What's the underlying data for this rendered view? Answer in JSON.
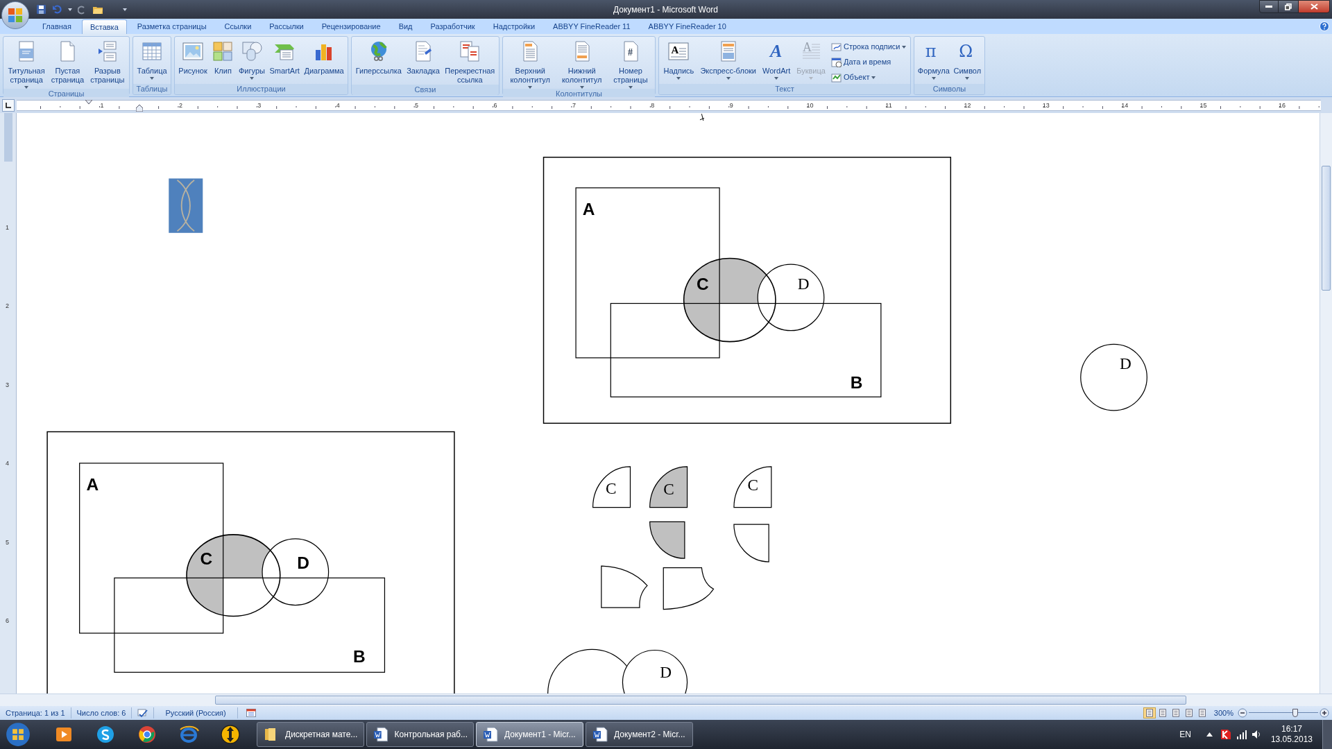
{
  "window": {
    "title": "Документ1 - Microsoft Word"
  },
  "tabs": [
    {
      "label": "Главная",
      "selected": false
    },
    {
      "label": "Вставка",
      "selected": true
    },
    {
      "label": "Разметка страницы",
      "selected": false
    },
    {
      "label": "Ссылки",
      "selected": false
    },
    {
      "label": "Рассылки",
      "selected": false
    },
    {
      "label": "Рецензирование",
      "selected": false
    },
    {
      "label": "Вид",
      "selected": false
    },
    {
      "label": "Разработчик",
      "selected": false
    },
    {
      "label": "Надстройки",
      "selected": false
    },
    {
      "label": "ABBYY FineReader 11",
      "selected": false
    },
    {
      "label": "ABBYY FineReader 10",
      "selected": false
    }
  ],
  "ribbon": {
    "groups": [
      {
        "label": "Страницы",
        "buttons": [
          {
            "kind": "large",
            "label": "Титульная\nстраница",
            "dropdown": true,
            "disabled": false
          },
          {
            "kind": "large",
            "label": "Пустая\nстраница",
            "dropdown": false,
            "disabled": false
          },
          {
            "kind": "large",
            "label": "Разрыв\nстраницы",
            "dropdown": false,
            "disabled": false
          }
        ]
      },
      {
        "label": "Таблицы",
        "buttons": [
          {
            "kind": "large",
            "label": "Таблица",
            "dropdown": true,
            "disabled": false
          }
        ]
      },
      {
        "label": "Иллюстрации",
        "buttons": [
          {
            "kind": "large",
            "label": "Рисунок",
            "dropdown": false,
            "disabled": false
          },
          {
            "kind": "large",
            "label": "Клип",
            "dropdown": false,
            "disabled": false
          },
          {
            "kind": "large",
            "label": "Фигуры",
            "dropdown": true,
            "disabled": false
          },
          {
            "kind": "large",
            "label": "SmartArt",
            "dropdown": false,
            "disabled": false
          },
          {
            "kind": "large",
            "label": "Диаграмма",
            "dropdown": false,
            "disabled": false
          }
        ]
      },
      {
        "label": "Связи",
        "buttons": [
          {
            "kind": "large",
            "label": "Гиперссылка",
            "dropdown": false,
            "disabled": false
          },
          {
            "kind": "large",
            "label": "Закладка",
            "dropdown": false,
            "disabled": false
          },
          {
            "kind": "large",
            "label": "Перекрестная\nссылка",
            "dropdown": false,
            "disabled": false
          }
        ]
      },
      {
        "label": "Колонтитулы",
        "buttons": [
          {
            "kind": "large",
            "label": "Верхний\nколонтитул",
            "dropdown": true,
            "disabled": false
          },
          {
            "kind": "large",
            "label": "Нижний\nколонтитул",
            "dropdown": true,
            "disabled": false
          },
          {
            "kind": "large",
            "label": "Номер\nстраницы",
            "dropdown": true,
            "disabled": false,
            "glyph": "#"
          }
        ]
      },
      {
        "label": "Текст",
        "buttons": [
          {
            "kind": "large",
            "label": "Надпись",
            "dropdown": true,
            "disabled": false,
            "glyph": "A"
          },
          {
            "kind": "large",
            "label": "Экспресс-блоки",
            "dropdown": true,
            "disabled": false
          },
          {
            "kind": "large",
            "label": "WordArt",
            "dropdown": true,
            "disabled": false,
            "glyph": "A"
          },
          {
            "kind": "large",
            "label": "Буквица",
            "dropdown": true,
            "disabled": true,
            "glyph": "A"
          },
          {
            "kind": "small",
            "label": "Строка подписи",
            "dropdown": true,
            "disabled": false
          },
          {
            "kind": "small",
            "label": "Дата и время",
            "dropdown": false,
            "disabled": false
          },
          {
            "kind": "small",
            "label": "Объект",
            "dropdown": true,
            "disabled": false
          }
        ]
      },
      {
        "label": "Символы",
        "buttons": [
          {
            "kind": "large",
            "label": "Формула",
            "dropdown": true,
            "disabled": false,
            "glyph": "π"
          },
          {
            "kind": "large",
            "label": "Символ",
            "dropdown": true,
            "disabled": false,
            "glyph": "Ω"
          }
        ]
      }
    ]
  },
  "ruler": {
    "marks": [
      "1",
      "2",
      "3",
      "4",
      "5",
      "6",
      "7",
      "8",
      "9",
      "10",
      "11",
      "12",
      "13",
      "14",
      "15",
      "16"
    ]
  },
  "vertical_ruler": {
    "marks": [
      "1",
      "2",
      "3",
      "4",
      "5",
      "6"
    ]
  },
  "document": {
    "diagrams": [
      {
        "labels": {
          "a": "A",
          "b": "B",
          "c": "C",
          "d": "D"
        }
      },
      {
        "labels": {
          "a": "A",
          "b": "B",
          "c": "C",
          "d": "D"
        }
      }
    ],
    "circle": {
      "label": "D"
    },
    "pieces": [
      {
        "shaded": false,
        "label": "C"
      },
      {
        "shaded": true,
        "label": "C"
      },
      {
        "shaded": false,
        "label": "C"
      },
      {
        "shaded": true
      },
      {
        "shaded": false
      },
      {
        "shaded": false
      },
      {
        "shaded": false
      }
    ],
    "overlap": {
      "label": "D"
    }
  },
  "status_bar": {
    "page": "Страница: 1 из 1",
    "words": "Число слов: 6",
    "language": "Русский (Россия)",
    "zoom": "300%",
    "zoom_slider": {
      "level": 0.69
    }
  },
  "taskbar": {
    "windows": [
      {
        "label": "Дискретная мате...",
        "selected": false
      },
      {
        "label": "Контрольная раб...",
        "selected": false
      },
      {
        "label": "Документ1 - Micr...",
        "selected": true
      },
      {
        "label": "Документ2 - Micr...",
        "selected": false
      }
    ],
    "language": "EN",
    "time": "16:17",
    "date": "13.05.2013"
  }
}
